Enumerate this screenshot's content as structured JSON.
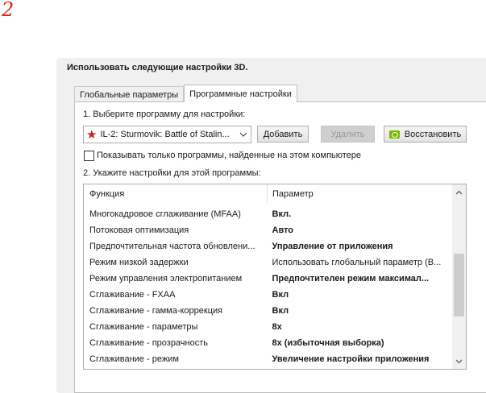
{
  "step_number": "2",
  "panel": {
    "title": "Использовать следующие настройки 3D."
  },
  "tabs": [
    {
      "label": "Глобальные параметры",
      "active": false
    },
    {
      "label": "Программные настройки",
      "active": true
    }
  ],
  "program": {
    "step_label": "1. Выберите программу для настройки:",
    "selected": "IL-2: Sturmovik: Battle of Stalin...",
    "icon": "red-star-icon",
    "add_label": "Добавить",
    "remove_label": "Удалить",
    "restore_label": "Восстановить",
    "restore_icon": "nvidia-logo-icon",
    "checkbox_label": "Показывать только программы, найденные на этом компьютере",
    "checkbox_checked": false
  },
  "settings": {
    "step_label": "2. Укажите настройки для этой программы:",
    "columns": [
      "Функция",
      "Параметр"
    ],
    "rows": [
      {
        "feature": "Многокадровое сглаживание (MFAA)",
        "value": "Вкл.",
        "bold": true
      },
      {
        "feature": "Потоковая оптимизация",
        "value": "Авто",
        "bold": true
      },
      {
        "feature": "Предпочтительная частота обновлени...",
        "value": "Управление от приложения",
        "bold": true
      },
      {
        "feature": "Режим низкой задержки",
        "value": "Использовать глобальный параметр (В...",
        "bold": false
      },
      {
        "feature": "Режим управления электропитанием",
        "value": "Предпочтителен режим максимал...",
        "bold": true
      },
      {
        "feature": "Сглаживание - FXAA",
        "value": "Вкл",
        "bold": true
      },
      {
        "feature": "Сглаживание - гамма-коррекция",
        "value": "Вкл",
        "bold": true
      },
      {
        "feature": "Сглаживание - параметры",
        "value": "8x",
        "bold": true
      },
      {
        "feature": "Сглаживание - прозрачность",
        "value": "8x (избыточная выборка)",
        "bold": true
      },
      {
        "feature": "Сглаживание - режим",
        "value": "Увеличение настройки приложения",
        "bold": true
      }
    ]
  },
  "colors": {
    "step_number": "#e0251b",
    "star": "#c9201e",
    "nvidia_green": "#76b900"
  }
}
